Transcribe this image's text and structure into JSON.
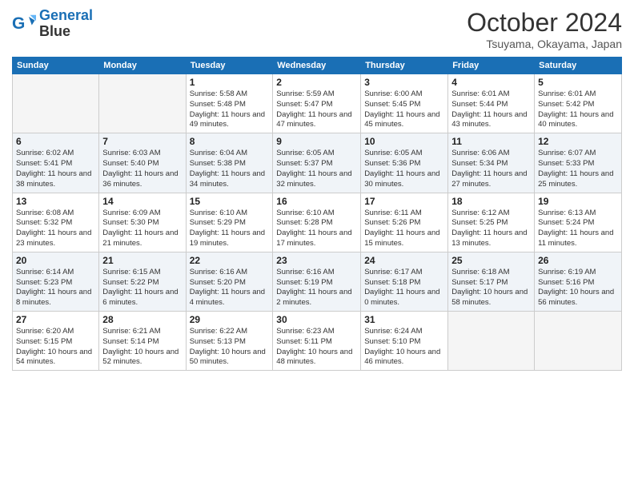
{
  "header": {
    "logo_line1": "General",
    "logo_line2": "Blue",
    "month_title": "October 2024",
    "location": "Tsuyama, Okayama, Japan"
  },
  "days_of_week": [
    "Sunday",
    "Monday",
    "Tuesday",
    "Wednesday",
    "Thursday",
    "Friday",
    "Saturday"
  ],
  "weeks": [
    [
      {
        "day": "",
        "info": ""
      },
      {
        "day": "",
        "info": ""
      },
      {
        "day": "1",
        "info": "Sunrise: 5:58 AM\nSunset: 5:48 PM\nDaylight: 11 hours and 49 minutes."
      },
      {
        "day": "2",
        "info": "Sunrise: 5:59 AM\nSunset: 5:47 PM\nDaylight: 11 hours and 47 minutes."
      },
      {
        "day": "3",
        "info": "Sunrise: 6:00 AM\nSunset: 5:45 PM\nDaylight: 11 hours and 45 minutes."
      },
      {
        "day": "4",
        "info": "Sunrise: 6:01 AM\nSunset: 5:44 PM\nDaylight: 11 hours and 43 minutes."
      },
      {
        "day": "5",
        "info": "Sunrise: 6:01 AM\nSunset: 5:42 PM\nDaylight: 11 hours and 40 minutes."
      }
    ],
    [
      {
        "day": "6",
        "info": "Sunrise: 6:02 AM\nSunset: 5:41 PM\nDaylight: 11 hours and 38 minutes."
      },
      {
        "day": "7",
        "info": "Sunrise: 6:03 AM\nSunset: 5:40 PM\nDaylight: 11 hours and 36 minutes."
      },
      {
        "day": "8",
        "info": "Sunrise: 6:04 AM\nSunset: 5:38 PM\nDaylight: 11 hours and 34 minutes."
      },
      {
        "day": "9",
        "info": "Sunrise: 6:05 AM\nSunset: 5:37 PM\nDaylight: 11 hours and 32 minutes."
      },
      {
        "day": "10",
        "info": "Sunrise: 6:05 AM\nSunset: 5:36 PM\nDaylight: 11 hours and 30 minutes."
      },
      {
        "day": "11",
        "info": "Sunrise: 6:06 AM\nSunset: 5:34 PM\nDaylight: 11 hours and 27 minutes."
      },
      {
        "day": "12",
        "info": "Sunrise: 6:07 AM\nSunset: 5:33 PM\nDaylight: 11 hours and 25 minutes."
      }
    ],
    [
      {
        "day": "13",
        "info": "Sunrise: 6:08 AM\nSunset: 5:32 PM\nDaylight: 11 hours and 23 minutes."
      },
      {
        "day": "14",
        "info": "Sunrise: 6:09 AM\nSunset: 5:30 PM\nDaylight: 11 hours and 21 minutes."
      },
      {
        "day": "15",
        "info": "Sunrise: 6:10 AM\nSunset: 5:29 PM\nDaylight: 11 hours and 19 minutes."
      },
      {
        "day": "16",
        "info": "Sunrise: 6:10 AM\nSunset: 5:28 PM\nDaylight: 11 hours and 17 minutes."
      },
      {
        "day": "17",
        "info": "Sunrise: 6:11 AM\nSunset: 5:26 PM\nDaylight: 11 hours and 15 minutes."
      },
      {
        "day": "18",
        "info": "Sunrise: 6:12 AM\nSunset: 5:25 PM\nDaylight: 11 hours and 13 minutes."
      },
      {
        "day": "19",
        "info": "Sunrise: 6:13 AM\nSunset: 5:24 PM\nDaylight: 11 hours and 11 minutes."
      }
    ],
    [
      {
        "day": "20",
        "info": "Sunrise: 6:14 AM\nSunset: 5:23 PM\nDaylight: 11 hours and 8 minutes."
      },
      {
        "day": "21",
        "info": "Sunrise: 6:15 AM\nSunset: 5:22 PM\nDaylight: 11 hours and 6 minutes."
      },
      {
        "day": "22",
        "info": "Sunrise: 6:16 AM\nSunset: 5:20 PM\nDaylight: 11 hours and 4 minutes."
      },
      {
        "day": "23",
        "info": "Sunrise: 6:16 AM\nSunset: 5:19 PM\nDaylight: 11 hours and 2 minutes."
      },
      {
        "day": "24",
        "info": "Sunrise: 6:17 AM\nSunset: 5:18 PM\nDaylight: 11 hours and 0 minutes."
      },
      {
        "day": "25",
        "info": "Sunrise: 6:18 AM\nSunset: 5:17 PM\nDaylight: 10 hours and 58 minutes."
      },
      {
        "day": "26",
        "info": "Sunrise: 6:19 AM\nSunset: 5:16 PM\nDaylight: 10 hours and 56 minutes."
      }
    ],
    [
      {
        "day": "27",
        "info": "Sunrise: 6:20 AM\nSunset: 5:15 PM\nDaylight: 10 hours and 54 minutes."
      },
      {
        "day": "28",
        "info": "Sunrise: 6:21 AM\nSunset: 5:14 PM\nDaylight: 10 hours and 52 minutes."
      },
      {
        "day": "29",
        "info": "Sunrise: 6:22 AM\nSunset: 5:13 PM\nDaylight: 10 hours and 50 minutes."
      },
      {
        "day": "30",
        "info": "Sunrise: 6:23 AM\nSunset: 5:11 PM\nDaylight: 10 hours and 48 minutes."
      },
      {
        "day": "31",
        "info": "Sunrise: 6:24 AM\nSunset: 5:10 PM\nDaylight: 10 hours and 46 minutes."
      },
      {
        "day": "",
        "info": ""
      },
      {
        "day": "",
        "info": ""
      }
    ]
  ]
}
